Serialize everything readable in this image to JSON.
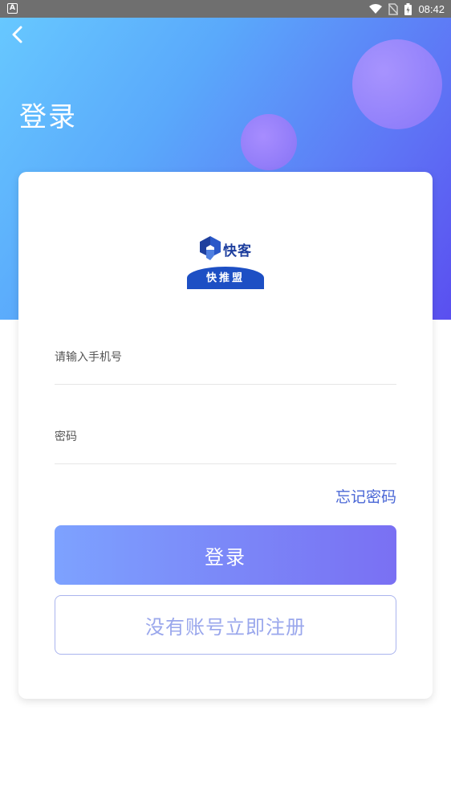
{
  "status_bar": {
    "notification_icon": "A",
    "time": "08:42",
    "icons": [
      "wifi-icon",
      "no-sim-icon",
      "battery-charging-icon"
    ]
  },
  "header": {
    "title": "登录",
    "back_icon": "chevron-left-icon"
  },
  "logo": {
    "brand_text": "快客",
    "band_text": "快推盟"
  },
  "form": {
    "phone_placeholder": "请输入手机号",
    "password_placeholder": "密码",
    "forgot_label": "忘记密码",
    "login_label": "登录",
    "register_label": "没有账号立即注册"
  },
  "colors": {
    "header_gradient_start": "#67c8ff",
    "header_gradient_end": "#5a4ff0",
    "accent": "#4a67d6",
    "login_button_start": "#7da2ff",
    "login_button_end": "#7a70f3",
    "register_text": "#9aa7ec"
  }
}
